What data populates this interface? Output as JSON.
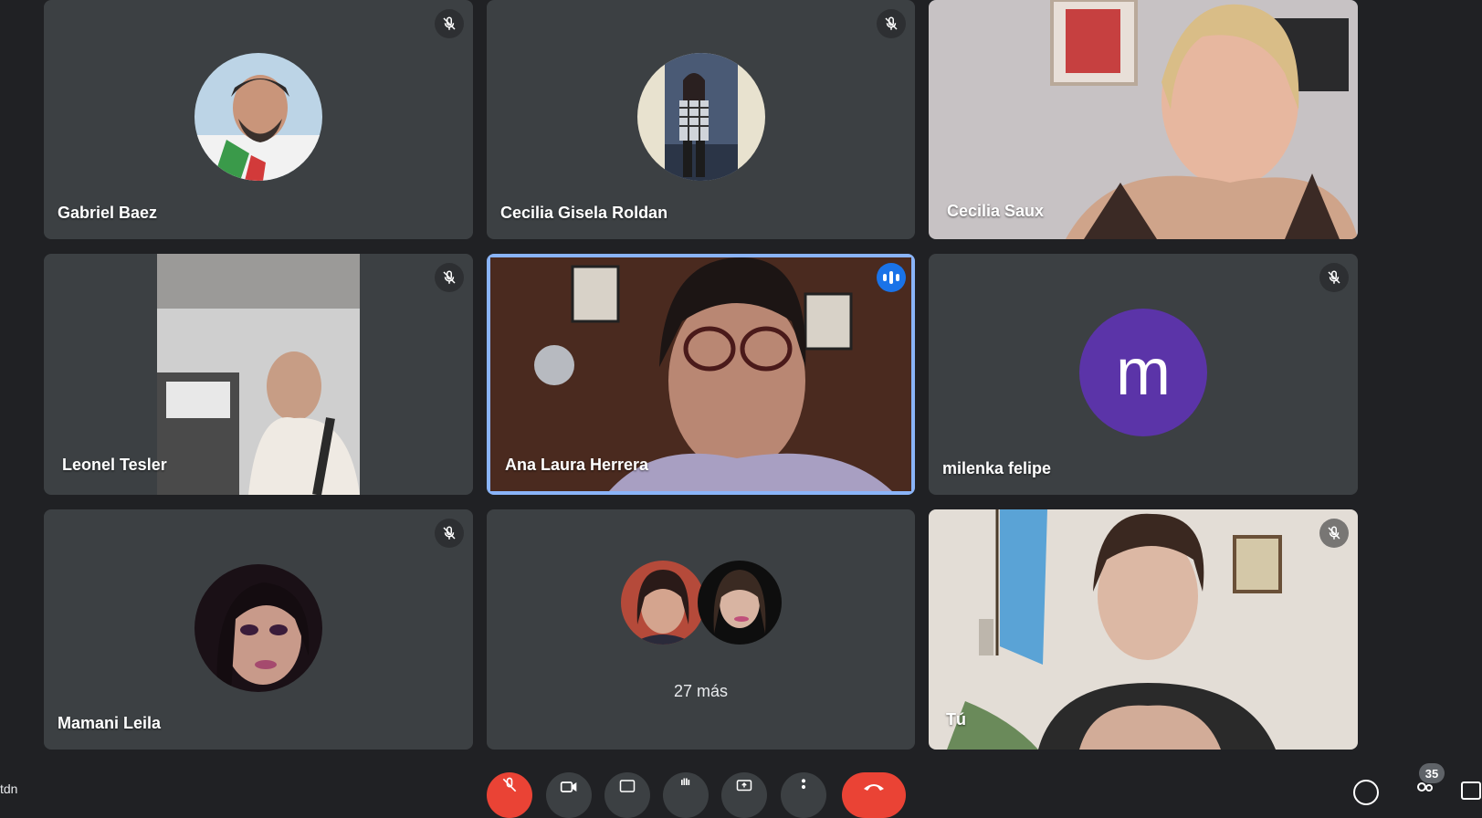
{
  "participants": [
    {
      "name": "Gabriel Baez"
    },
    {
      "name": "Cecilia Gisela Roldan"
    },
    {
      "name": "Cecilia Saux"
    },
    {
      "name": "Leonel Tesler"
    },
    {
      "name": "Ana Laura Herrera"
    },
    {
      "name": "milenka felipe",
      "initial": "m"
    },
    {
      "name": "Mamani Leila"
    },
    {
      "more_label": "27 más"
    },
    {
      "name": "Tú"
    }
  ],
  "toolbar": {
    "participant_count": "35",
    "cut_text": "tdn"
  },
  "colors": {
    "background": "#202124",
    "tile": "#3c4043",
    "speaking_border": "#8ab4f8",
    "speaking_badge": "#1a73e8",
    "avatar_purple": "#5b34a8",
    "end_call": "#ea4335"
  }
}
